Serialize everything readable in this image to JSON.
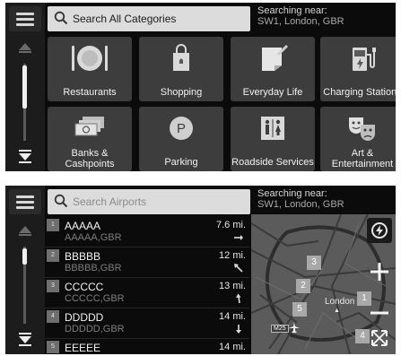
{
  "categories_screen": {
    "search": {
      "placeholder": "Search All Categories"
    },
    "near": {
      "label": "Searching near:",
      "value": "SW1, London, GBR"
    },
    "tiles": [
      {
        "label": "Restaurants",
        "icon": "restaurant-icon"
      },
      {
        "label": "Shopping",
        "icon": "shopping-bag-icon"
      },
      {
        "label": "Everyday Life",
        "icon": "everyday-life-icon"
      },
      {
        "label": "Charging Stations",
        "icon": "charging-station-icon"
      },
      {
        "label": "Banks &\nCashpoints",
        "icon": "money-icon"
      },
      {
        "label": "Parking",
        "icon": "parking-icon"
      },
      {
        "label": "Roadside Services",
        "icon": "restroom-icon"
      },
      {
        "label": "Art &\nEntertainment",
        "icon": "theater-masks-icon"
      }
    ]
  },
  "airports_screen": {
    "search": {
      "placeholder": "Search Airports"
    },
    "near": {
      "label": "Searching near:",
      "value": "SW1, London, GBR"
    },
    "results": [
      {
        "index": "1",
        "name": "AAAAA",
        "address": "AAAAA,GBR",
        "distance": "7.6 mi.",
        "direction": "east"
      },
      {
        "index": "2",
        "name": "BBBBB",
        "address": "BBBBB,GBR",
        "distance": "12 mi.",
        "direction": "north-west"
      },
      {
        "index": "3",
        "name": "CCCCC",
        "address": "CCCCC,GBR",
        "distance": "13 mi.",
        "direction": "north-north-west"
      },
      {
        "index": "4",
        "name": "DDDDD",
        "address": "DDDDD,GBR",
        "distance": "14 mi.",
        "direction": "south"
      },
      {
        "index": "5",
        "name": "EEEEE",
        "address": "",
        "distance": "14 mi.",
        "direction": ""
      }
    ],
    "map": {
      "city_label": "London",
      "road_label": "M25",
      "markers": [
        "1",
        "2",
        "3",
        "4",
        "5"
      ]
    }
  },
  "colors": {
    "screen_bg": "#0b0b0b",
    "tile_bg": "#3d3d3d",
    "rail_bg": "#1c1c1c",
    "search_bg": "#dcdcdc",
    "map_bg": "#5b5b5b",
    "marker_bg": "#a8a8a8"
  }
}
